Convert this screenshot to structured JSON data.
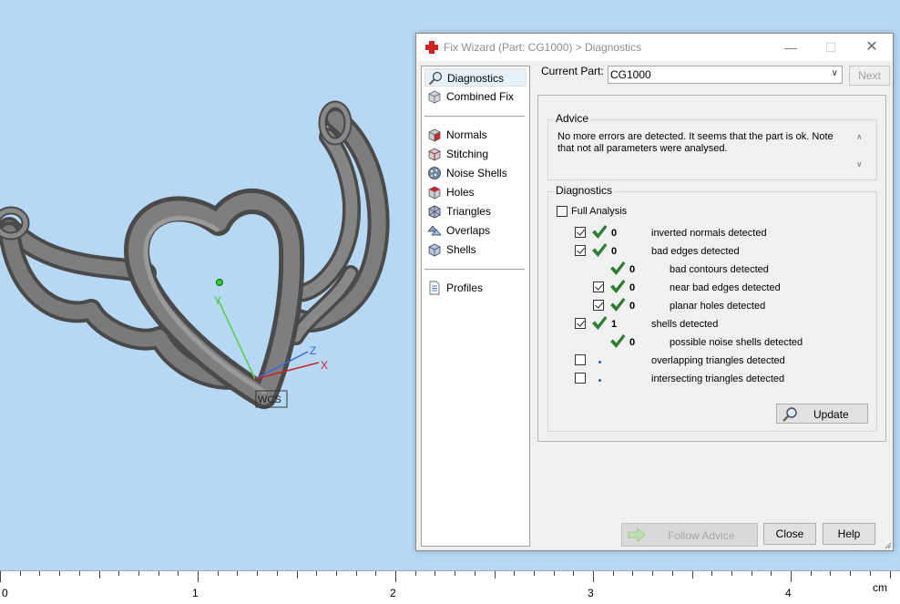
{
  "viewport": {
    "axis_labels": {
      "y": "Y",
      "z": "Z",
      "x": "X"
    },
    "wcs_label": "WCS"
  },
  "ruler": {
    "labels": [
      "0",
      "1",
      "2",
      "3",
      "4"
    ],
    "unit": "cm"
  },
  "dialog": {
    "title": "Fix Wizard (Part: CG1000) > Diagnostics",
    "window_buttons": {
      "minimize": "—",
      "maximize": "☐",
      "close": "✕"
    },
    "sidebar": {
      "groups": [
        [
          {
            "label": "Diagnostics",
            "icon": "magnifier-icon",
            "selected": true
          },
          {
            "label": "Combined Fix",
            "icon": "cube-icon"
          }
        ],
        [
          {
            "label": "Normals",
            "icon": "normals-cube-icon"
          },
          {
            "label": "Stitching",
            "icon": "stitching-cube-icon"
          },
          {
            "label": "Noise Shells",
            "icon": "noise-shells-icon"
          },
          {
            "label": "Holes",
            "icon": "holes-cube-icon"
          },
          {
            "label": "Triangles",
            "icon": "triangles-icon"
          },
          {
            "label": "Overlaps",
            "icon": "overlaps-icon"
          },
          {
            "label": "Shells",
            "icon": "shells-icon"
          }
        ],
        [
          {
            "label": "Profiles",
            "icon": "document-icon"
          }
        ]
      ]
    },
    "current_part": {
      "label": "Current Part:",
      "value": "CG1000",
      "next_label": "Next"
    },
    "advice": {
      "title": "Advice",
      "text": "No more errors are detected. It seems that the part is ok. Note that not all parameters were analysed."
    },
    "diagnostics": {
      "title": "Diagnostics",
      "full_analysis_label": "Full Analysis",
      "full_analysis_checked": false,
      "rows": [
        {
          "label": "inverted normals detected",
          "count": "0",
          "checked": true,
          "has_checkbox": true,
          "status": "ok",
          "indent": 0
        },
        {
          "label": "bad edges detected",
          "count": "0",
          "checked": true,
          "has_checkbox": true,
          "status": "ok",
          "indent": 0
        },
        {
          "label": "bad contours detected",
          "count": "0",
          "checked": false,
          "has_checkbox": false,
          "status": "ok",
          "indent": 1
        },
        {
          "label": "near bad edges detected",
          "count": "0",
          "checked": true,
          "has_checkbox": true,
          "status": "ok",
          "indent": 1
        },
        {
          "label": "planar holes detected",
          "count": "0",
          "checked": true,
          "has_checkbox": true,
          "status": "ok",
          "indent": 1
        },
        {
          "label": "shells detected",
          "count": "1",
          "checked": true,
          "has_checkbox": true,
          "status": "ok",
          "indent": 0
        },
        {
          "label": "possible noise shells detected",
          "count": "0",
          "checked": false,
          "has_checkbox": false,
          "status": "ok",
          "indent": 1
        },
        {
          "label": "overlapping triangles detected",
          "count": "",
          "checked": false,
          "has_checkbox": true,
          "status": "unknown",
          "indent": 0
        },
        {
          "label": "intersecting triangles detected",
          "count": "",
          "checked": false,
          "has_checkbox": true,
          "status": "unknown",
          "indent": 0
        }
      ],
      "update_label": "Update"
    },
    "buttons": {
      "follow_advice": "Follow Advice",
      "close": "Close",
      "help": "Help"
    }
  },
  "colors": {
    "viewport_bg": "#b7d8f5",
    "check_green": "#2e7d32",
    "axis_x": "#cc2222",
    "axis_y": "#44bb33",
    "axis_z": "#3366dd"
  }
}
